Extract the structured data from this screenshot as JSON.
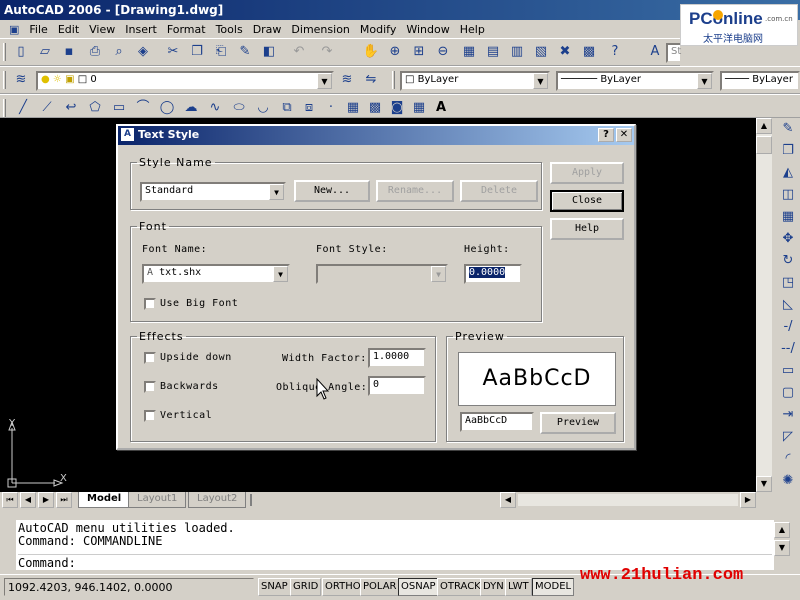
{
  "app": {
    "title": "AutoCAD 2006 - [Drawing1.dwg]"
  },
  "menu": [
    "File",
    "Edit",
    "View",
    "Insert",
    "Format",
    "Tools",
    "Draw",
    "Dimension",
    "Modify",
    "Window",
    "Help"
  ],
  "logo": {
    "brand": "PConline",
    "domain": ".com.cn",
    "subtitle": "太平洋电脑网"
  },
  "toolbar": {
    "layer_value": "0",
    "color_value": "ByLayer",
    "linetype_value": "ByLayer",
    "lineweight_value": "ByLayer",
    "style_search_placeholder": "St"
  },
  "ucs": {
    "x": "X",
    "y": "Y"
  },
  "tabs": {
    "model": "Model",
    "layout1": "Layout1",
    "layout2": "Layout2"
  },
  "command": {
    "lines": [
      "AutoCAD menu utilities loaded.",
      "Command: COMMANDLINE"
    ],
    "prompt": "Command:"
  },
  "status": {
    "coords": "1092.4203, 946.1402, 0.0000",
    "buttons": [
      "SNAP",
      "GRID",
      "ORTHO",
      "POLAR",
      "OSNAP",
      "OTRACK",
      "DYN",
      "LWT",
      "MODEL"
    ],
    "watermark": "www.21hulian.com"
  },
  "dialog": {
    "title": "Text Style",
    "help_glyph": "?",
    "close_glyph": "✕",
    "style_name_group": "Style Name",
    "style_name_value": "Standard",
    "new_button": "New...",
    "rename_button": "Rename...",
    "delete_button": "Delete",
    "apply_button": "Apply",
    "close_button": "Close",
    "help_button": "Help",
    "font_group": "Font",
    "font_name_label": "Font Name:",
    "font_name_value": "txt.shx",
    "font_style_label": "Font Style:",
    "font_style_value": "",
    "height_label": "Height:",
    "height_value": "0.0000",
    "use_big_font_label": "Use Big Font",
    "effects_group": "Effects",
    "upside_down_label": "Upside down",
    "backwards_label": "Backwards",
    "vertical_label": "Vertical",
    "width_factor_label": "Width Factor:",
    "width_factor_value": "1.0000",
    "oblique_angle_label": "Oblique Angle:",
    "oblique_angle_value": "0",
    "preview_group": "Preview",
    "preview_sample": "AaBbCcD",
    "preview_input_value": "AaBbCcD",
    "preview_button": "Preview"
  }
}
